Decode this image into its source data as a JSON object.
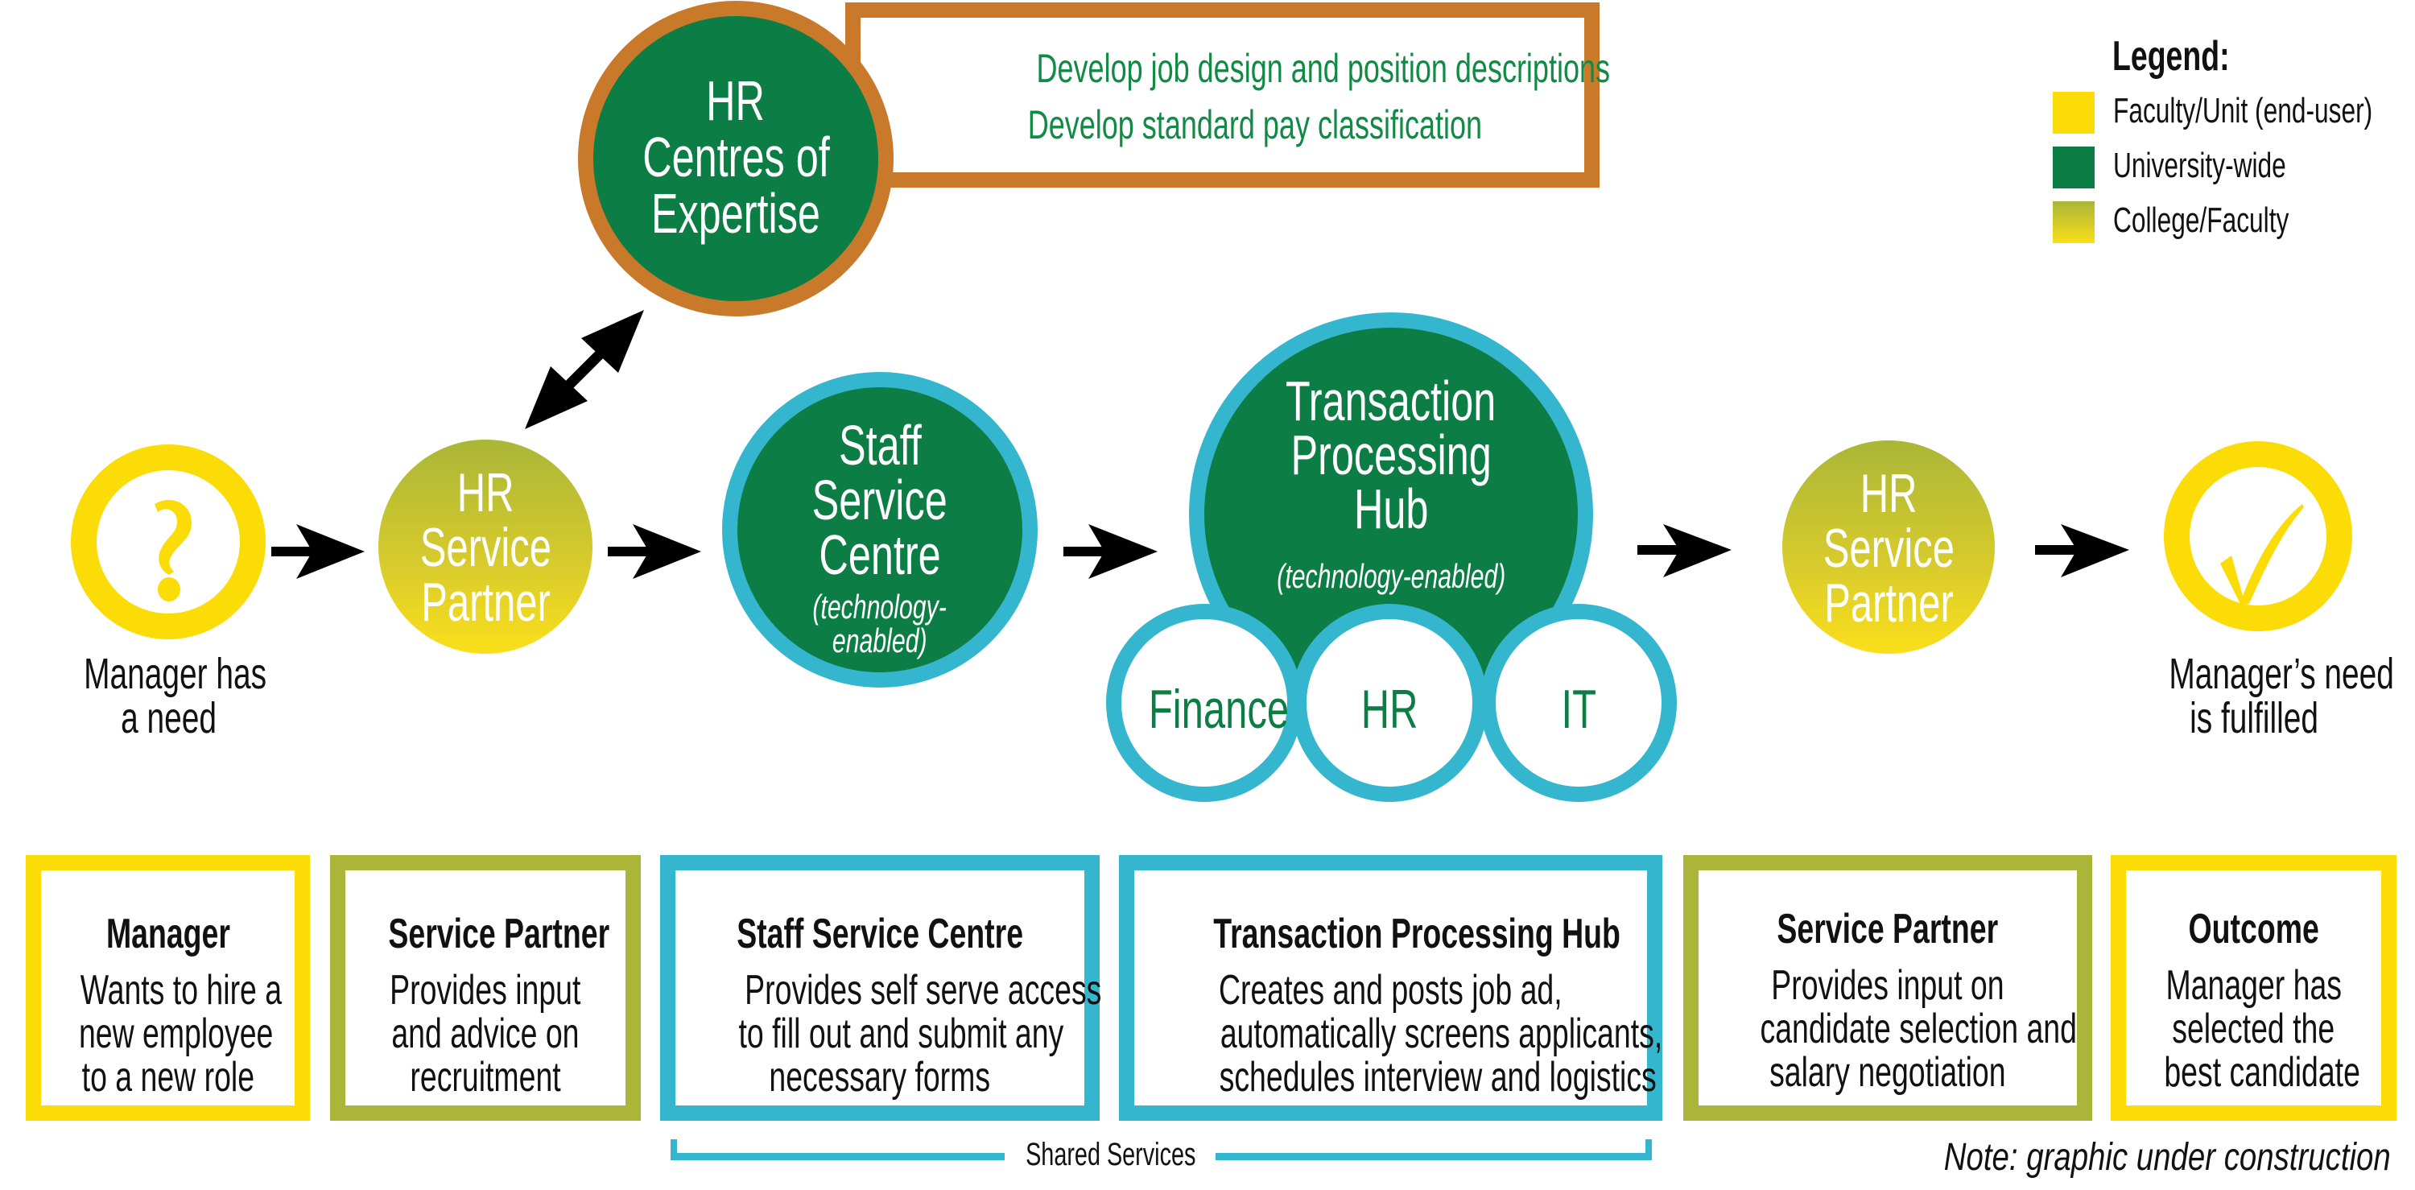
{
  "centres_of_expertise": {
    "title_lines": [
      "HR",
      "Centres of",
      "Expertise"
    ],
    "tasks": [
      "Develop job design and position descriptions",
      "Develop standard pay classification"
    ]
  },
  "flow": {
    "start": {
      "icon": "question-mark-icon",
      "label_lines": [
        "Manager has",
        "a need"
      ]
    },
    "service_partner_left": {
      "title_lines": [
        "HR",
        "Service",
        "Partner"
      ]
    },
    "staff_service_centre": {
      "title_lines": [
        "Staff",
        "Service",
        "Centre"
      ],
      "note_lines": [
        "(technology-",
        "enabled)"
      ]
    },
    "transaction_hub": {
      "title_lines": [
        "Transaction",
        "Processing",
        "Hub"
      ],
      "note": "(technology-enabled)",
      "units": [
        "Finance",
        "HR",
        "IT"
      ]
    },
    "service_partner_right": {
      "title_lines": [
        "HR",
        "Service",
        "Partner"
      ]
    },
    "end": {
      "icon": "checkmark-icon",
      "label_lines": [
        "Manager’s need",
        "is fulfilled"
      ]
    }
  },
  "boxes": [
    {
      "title": "Manager",
      "lines": [
        "Wants to hire a",
        "new employee",
        "to a new role"
      ],
      "category": "Faculty/Unit (end-user)"
    },
    {
      "title": "Service Partner",
      "lines": [
        "Provides input",
        "and advice on",
        "recruitment"
      ],
      "category": "College/Faculty"
    },
    {
      "title": "Staff Service Centre",
      "lines": [
        "Provides self serve access",
        "to fill out and submit any",
        "necessary forms"
      ],
      "category": "Shared Services"
    },
    {
      "title": "Transaction Processing Hub",
      "lines": [
        "Creates and posts job ad,",
        "automatically screens applicants,",
        "schedules interview and logistics"
      ],
      "category": "Shared Services"
    },
    {
      "title": "Service Partner",
      "lines": [
        "Provides input on",
        "candidate selection and",
        "salary negotiation"
      ],
      "category": "College/Faculty"
    },
    {
      "title": "Outcome",
      "lines": [
        "Manager has",
        "selected the",
        "best candidate"
      ],
      "category": "Faculty/Unit (end-user)"
    }
  ],
  "shared_services_label": "Shared Services",
  "legend": {
    "title": "Legend:",
    "items": [
      {
        "label": "Faculty/Unit (end-user)",
        "color": "#fbdc06"
      },
      {
        "label": "University-wide",
        "color": "#0c7d44"
      },
      {
        "label": "College/Faculty",
        "color": "gradient #aab637 → #fbdf1a"
      }
    ]
  },
  "note": "Note: graphic under construction",
  "colors": {
    "yellow": "#fbdc06",
    "green": "#0c7d44",
    "olive": "#aab53a",
    "blue": "#35b6cf",
    "orange": "#c8792a"
  }
}
